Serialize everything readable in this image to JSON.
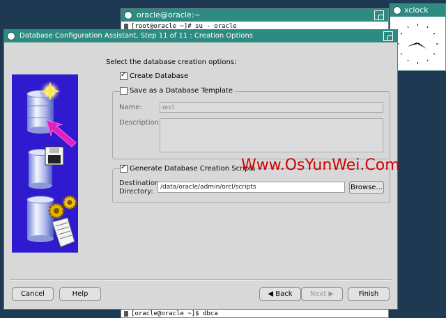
{
  "terminal": {
    "title": "oracle@oracle:~",
    "top_line": "[root@oracle ~]# su - oracle",
    "bottom_line": "[oracle@oracle ~]$ dbca"
  },
  "xclock": {
    "title": "xclock"
  },
  "dialog": {
    "title": "Database Configuration Assistant, Step 11 of 11 : Creation Options",
    "prompt": "Select the database creation options:",
    "create_database": {
      "label": "Create Database",
      "checked": true
    },
    "template": {
      "label": "Save as a Database Template",
      "checked": false,
      "name_label": "Name:",
      "name_value": "orcl",
      "description_label": "Description:",
      "description_value": ""
    },
    "scripts": {
      "label": "Generate Database Creation Scripts",
      "checked": true,
      "dest_label_1": "Destination",
      "dest_label_2": "Directory:",
      "dest_value": "/data/oracle/admin/orcl/scripts",
      "browse_label": "Browse..."
    },
    "buttons": {
      "cancel": "Cancel",
      "help": "Help",
      "back": "Back",
      "next": "Next",
      "finish": "Finish"
    }
  },
  "watermark": "Www.OsYunWei.Com",
  "colors": {
    "titlebar": "#2e8b82",
    "dialog_bg": "#d8d8d8",
    "illustration_bg": "#2f1ad0",
    "desktop": "#1e3a52",
    "watermark": "#d10000"
  }
}
